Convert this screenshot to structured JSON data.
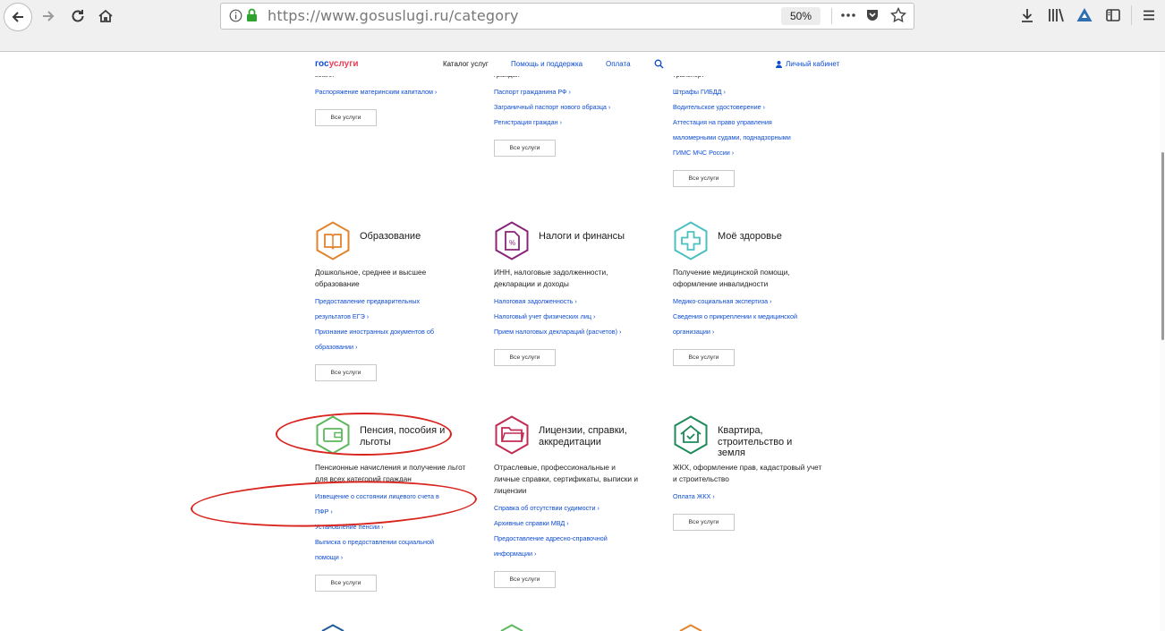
{
  "browser": {
    "url": "https://www.gosuslugi.ru/category",
    "zoom": "50%",
    "colors": {
      "chrome": "#f0f0f0",
      "url_text": "#787878"
    }
  },
  "site": {
    "logo": {
      "part1": "гос",
      "part2": "услуги"
    },
    "nav": {
      "catalog": "Каталог услуг",
      "help": "Помощь и поддержка",
      "payment": "Оплата",
      "cabinet": "Личный кабинет"
    },
    "colors": {
      "brand_blue": "#0d4cd3",
      "brand_red": "#ee3f58",
      "annotation_red": "#d9241e"
    }
  },
  "cut_top": {
    "col1": {
      "partial_title": "земля",
      "links": [
        "Распоряжение материнским капиталом ›"
      ],
      "button": "Все услуги"
    },
    "col2": {
      "partial_title": "граждан",
      "links": [
        "Паспорт гражданина РФ ›",
        "Заграничный паспорт нового образца ›",
        "Регистрация граждан ›"
      ],
      "button": "Все услуги"
    },
    "col3": {
      "partial_title": "транспорт",
      "links": [
        "Штрафы ГИБДД ›",
        "Водительское удостоверение ›",
        "Аттестация на право управления",
        "маломерными судами, поднадзорными",
        "ГИМС МЧС России ›"
      ],
      "button": "Все услуги"
    }
  },
  "row2": {
    "education": {
      "icon": "book-icon",
      "title": "Образование",
      "desc": "Дошкольное, среднее и высшее образование",
      "links": [
        "Предоставление предварительных",
        "результатов ЕГЭ ›",
        "Признание иностранных документов об",
        "образовании ›"
      ],
      "button": "Все услуги"
    },
    "taxes": {
      "icon": "tax-document-icon",
      "title": "Налоги и финансы",
      "desc": "ИНН, налоговые задолженности, декларации и доходы",
      "links": [
        "Налоговая задолженность ›",
        "Налоговый учет физических лиц ›",
        "Прием налоговых деклараций (расчетов) ›"
      ],
      "button": "Все услуги"
    },
    "health": {
      "icon": "medical-cross-icon",
      "title": "Моё здоровье",
      "desc": "Получение медицинской помощи, оформление инвалидности",
      "links": [
        "Медико-социальная экспертиза ›",
        "Сведения о прикреплении к медицинской",
        "организации ›"
      ],
      "button": "Все услуги"
    }
  },
  "row3": {
    "pension": {
      "icon": "wallet-icon",
      "title_line1": "Пенсия, пособия и",
      "title_line2": "льготы",
      "desc": "Пенсионные начисления и получение льгот для всех категорий граждан",
      "links": [
        "Извещение о состоянии лицевого счета в",
        "ПФР ›",
        "Установление пенсии ›",
        "Выписка о предоставлении социальной",
        "помощи ›"
      ],
      "button": "Все услуги"
    },
    "licenses": {
      "icon": "folder-icon",
      "title_line1": "Лицензии, справки,",
      "title_line2": "аккредитации",
      "desc": "Отраслевые, профессиональные и личные справки, сертификаты, выписки и лицензии",
      "links": [
        "Справка об отсутствии судимости ›",
        "Архивные справки МВД ›",
        "Предоставление адресно-справочной",
        "информации ›"
      ],
      "button": "Все услуги"
    },
    "housing": {
      "icon": "house-check-icon",
      "title_line1": "Квартира,",
      "title_line2": "строительство и",
      "title_line3": "земля",
      "desc": "ЖКХ, оформление прав, кадастровый учет и строительство",
      "links": [
        "Оплата ЖКХ ›"
      ],
      "button": "Все услуги"
    }
  },
  "icon_colors": {
    "education": "#e3832d",
    "taxes": "#8a2479",
    "health": "#4cc0c0",
    "pension": "#5cb85c",
    "licenses": "#c22b54",
    "housing": "#1e8a5a"
  }
}
